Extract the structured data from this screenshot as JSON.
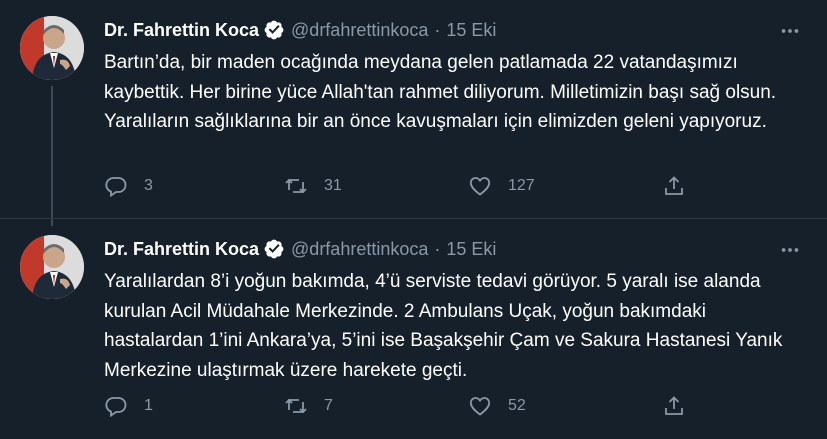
{
  "tweets": [
    {
      "author_name": "Dr. Fahrettin Koca",
      "handle": "@drfahrettinkoca",
      "separator": "·",
      "date": "15 Eki",
      "text": "Bartın’da, bir maden ocağında meydana gelen patlamada 22 vatandaşımızı kaybettik. Her birine yüce Allah'tan rahmet diliyorum. Milletimizin başı sağ olsun. Yaralıların sağlıklarına bir an önce kavuşmaları için elimizden geleni yapıyoruz.",
      "replies": "3",
      "retweets": "31",
      "likes": "127"
    },
    {
      "author_name": "Dr. Fahrettin Koca",
      "handle": "@drfahrettinkoca",
      "separator": "·",
      "date": "15 Eki",
      "text": "Yaralılardan 8’i yoğun bakımda, 4’ü serviste tedavi görüyor. 5 yaralı ise alanda kurulan Acil Müdahale Merkezinde. 2 Ambulans Uçak, yoğun bakımdaki hastalardan 1’ini Ankara’ya, 5’ini ise Başakşehir Çam ve Sakura Hastanesi Yanık Merkezine ulaştırmak üzere harekete geçti.",
      "replies": "1",
      "retweets": "7",
      "likes": "52"
    }
  ],
  "icons": {
    "verified": "verified-badge-icon",
    "more": "more-horizontal-icon",
    "reply": "reply-icon",
    "retweet": "retweet-icon",
    "like": "heart-icon",
    "share": "share-icon"
  },
  "colors": {
    "background": "#15202b",
    "muted": "#8b98a5",
    "verified": "#ffffff"
  }
}
